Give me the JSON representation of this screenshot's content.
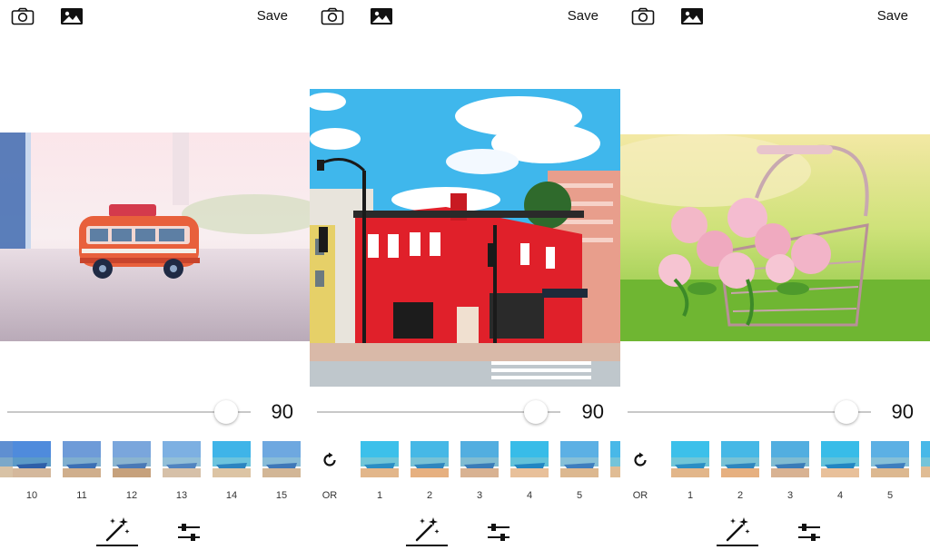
{
  "icons": {
    "camera": "camera-icon",
    "gallery": "gallery-icon",
    "reset": "rotate-ccw-icon",
    "magic": "magic-wand-icon",
    "adjust": "sliders-icon"
  },
  "colors": {
    "accent": "#111111",
    "track": "#c8c8c8"
  },
  "screens": [
    {
      "save_label": "Save",
      "photo": "toy-bus",
      "slider": {
        "value": 90,
        "value_label": "90",
        "fraction": 0.9
      },
      "reset_label": "",
      "filters": [
        "10",
        "11",
        "12",
        "13",
        "14",
        "15"
      ]
    },
    {
      "save_label": "Save",
      "photo": "red-building",
      "slider": {
        "value": 90,
        "value_label": "90",
        "fraction": 0.9
      },
      "reset_label": "OR",
      "filters": [
        "1",
        "2",
        "3",
        "4",
        "5"
      ]
    },
    {
      "save_label": "Save",
      "photo": "rose-basket",
      "slider": {
        "value": 90,
        "value_label": "90",
        "fraction": 0.9
      },
      "reset_label": "OR",
      "filters": [
        "1",
        "2",
        "3",
        "4",
        "5"
      ]
    }
  ]
}
